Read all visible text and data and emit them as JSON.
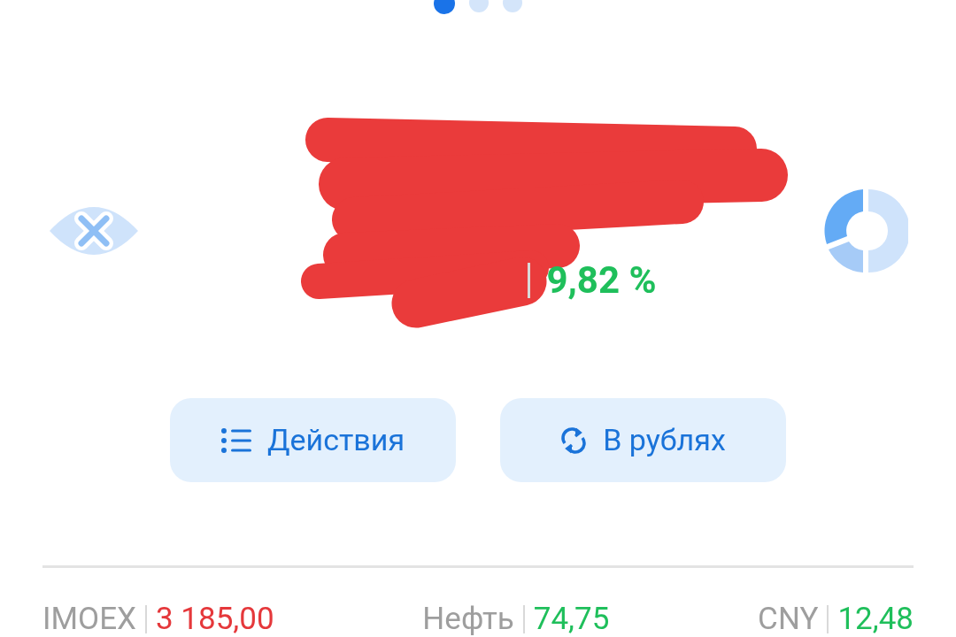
{
  "page_dots": [
    {
      "selected": true
    },
    {
      "selected": false
    },
    {
      "selected": false
    }
  ],
  "portfolio": {
    "change": "9,82 %",
    "color": "#1fbf5b"
  },
  "buttons": [
    {
      "label": "Действия",
      "kind": "list"
    },
    {
      "label": "В рублях",
      "kind": "refresh"
    }
  ],
  "tickers": [
    {
      "name": "IMOEX",
      "value": "3 185,00",
      "color": "#e5383b"
    },
    {
      "name": "Нефть",
      "value": "74,75",
      "color": "#1fbf5b"
    },
    {
      "name": "CNY",
      "value": "12,48",
      "color": "#1fbf5b"
    }
  ]
}
